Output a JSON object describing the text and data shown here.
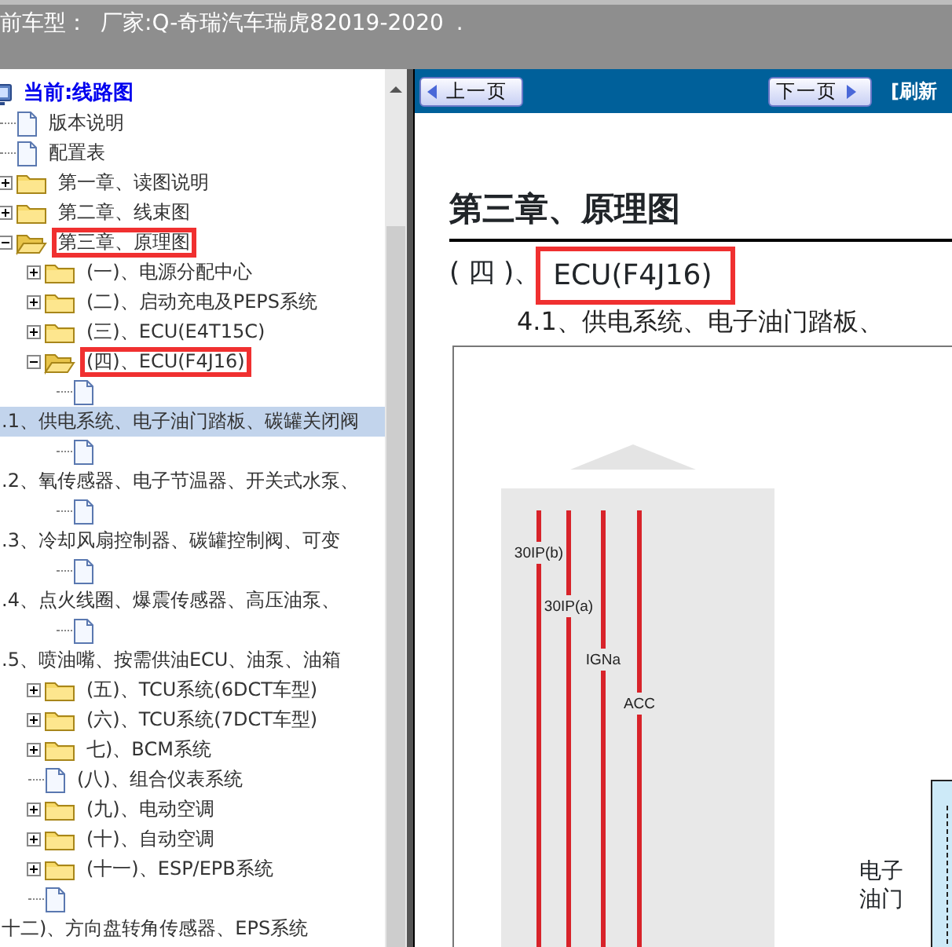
{
  "top_bar": {
    "vehicle_label": "前车型：",
    "vehicle": "厂家:Q-奇瑞汽车瑞虎82019-2020",
    "trailing": "."
  },
  "tree": {
    "label": "当前:线路图",
    "kind": "root",
    "selected": false,
    "outlined": false,
    "children": [
      {
        "label": "版本说明",
        "kind": "doc",
        "selected": false,
        "outlined": false
      },
      {
        "label": "配置表",
        "kind": "doc",
        "selected": false,
        "outlined": false
      },
      {
        "label": "第一章、读图说明",
        "kind": "folder",
        "expanded": false,
        "selected": false,
        "outlined": false
      },
      {
        "label": "第二章、线束图",
        "kind": "folder",
        "expanded": false,
        "selected": false,
        "outlined": false
      },
      {
        "label": "第三章、原理图",
        "kind": "folder",
        "expanded": true,
        "selected": false,
        "outlined": true,
        "children": [
          {
            "label": "(一)、电源分配中心",
            "kind": "folder",
            "expanded": false,
            "selected": false,
            "outlined": false
          },
          {
            "label": "(二)、启动充电及PEPS系统",
            "kind": "folder",
            "expanded": false,
            "selected": false,
            "outlined": false
          },
          {
            "label": "(三)、ECU(E4T15C)",
            "kind": "folder",
            "expanded": false,
            "selected": false,
            "outlined": false
          },
          {
            "label": "(四)、ECU(F4J16)",
            "kind": "folder",
            "expanded": true,
            "selected": false,
            "outlined": true,
            "children": [
              {
                "label": ".1、供电系统、电子油门踏板、碳罐关闭阀",
                "kind": "page",
                "selected": true,
                "outlined": false
              },
              {
                "label": ".2、氧传感器、电子节温器、开关式水泵、",
                "kind": "page",
                "selected": false,
                "outlined": false
              },
              {
                "label": ".3、冷却风扇控制器、碳罐控制阀、可变",
                "kind": "page",
                "selected": false,
                "outlined": false
              },
              {
                "label": ".4、点火线圈、爆震传感器、高压油泵、",
                "kind": "page",
                "selected": false,
                "outlined": false
              },
              {
                "label": ".5、喷油嘴、按需供油ECU、油泵、油箱",
                "kind": "page",
                "selected": false,
                "outlined": false
              }
            ]
          },
          {
            "label": "(五)、TCU系统(6DCT车型)",
            "kind": "folder",
            "expanded": false,
            "selected": false,
            "outlined": false
          },
          {
            "label": "(六)、TCU系统(7DCT车型)",
            "kind": "folder",
            "expanded": false,
            "selected": false,
            "outlined": false
          },
          {
            "label": "七)、BCM系统",
            "kind": "folder",
            "expanded": false,
            "selected": false,
            "outlined": false
          },
          {
            "label": "(八)、组合仪表系统",
            "kind": "doc",
            "selected": false,
            "outlined": false
          },
          {
            "label": "(九)、电动空调",
            "kind": "folder",
            "expanded": false,
            "selected": false,
            "outlined": false
          },
          {
            "label": "(十)、自动空调",
            "kind": "folder",
            "expanded": false,
            "selected": false,
            "outlined": false
          },
          {
            "label": "(十一)、ESP/EPB系统",
            "kind": "folder",
            "expanded": false,
            "selected": false,
            "outlined": false
          },
          {
            "label": "十二)、方向盘转角传感器、EPS系统",
            "kind": "page",
            "selected": false,
            "outlined": false
          }
        ]
      }
    ]
  },
  "toolbar": {
    "prev": "上一页",
    "next": "下一页",
    "refresh": "[刷新"
  },
  "document": {
    "title": "第三章、原理图",
    "section_prefix": "( 四 )、",
    "section_name": "ECU(F4J16)",
    "section_outlined": true,
    "subsection": "4.1、供电系统、电子油门踏板、",
    "diagram": {
      "wire_labels": [
        "30IP(b)",
        "30IP(a)",
        "IGNa",
        "ACC"
      ],
      "side_label": "电子油门"
    }
  }
}
